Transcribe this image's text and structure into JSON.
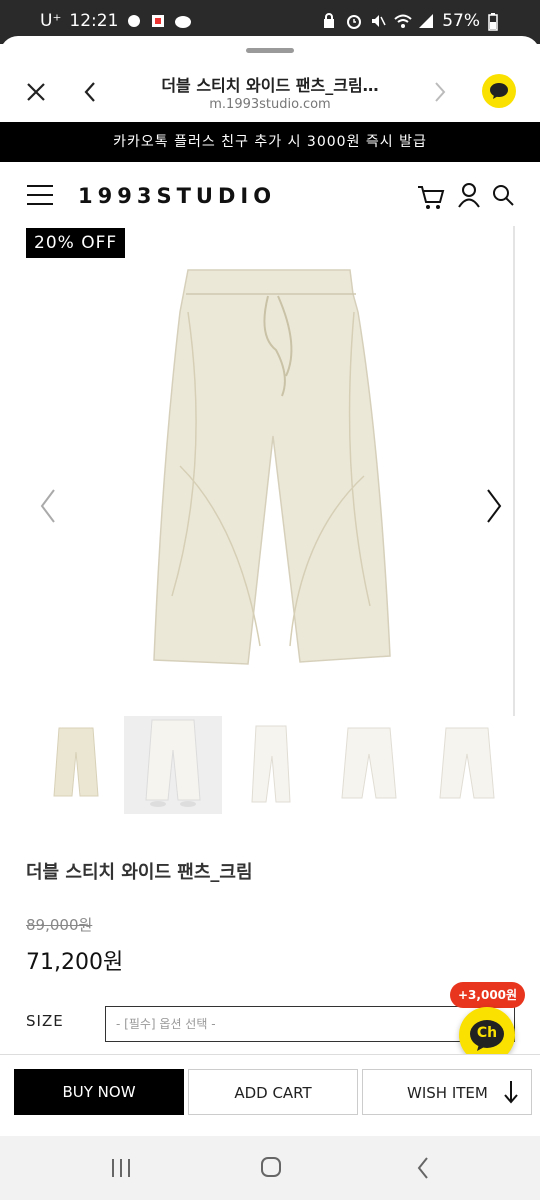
{
  "status_bar": {
    "carrier": "U⁺",
    "time": "12:21",
    "battery": "57%"
  },
  "browser": {
    "title": "더블 스티치 와이드 팬츠_크림…",
    "url": "m.1993studio.com"
  },
  "promo_banner": "카카오톡 플러스 친구 추가 시 3000원 즉시 발급",
  "site": {
    "logo": "1993STUDIO"
  },
  "product": {
    "discount_badge": "20% OFF",
    "name": "더블 스티치 와이드 팬츠_크림",
    "original_price": "89,000원",
    "sale_price": "71,200원",
    "size_label": "SIZE",
    "size_placeholder": "- [필수] 옵션 선택 -",
    "thumbnail_count": 5
  },
  "floating": {
    "points_badge": "+3,000원",
    "channel_label": "Ch"
  },
  "actions": {
    "buy_now": "BUY NOW",
    "add_cart": "ADD CART",
    "wish_item": "WISH ITEM"
  },
  "colors": {
    "banner_bg": "#000000",
    "kakao_yellow": "#fae100",
    "points_red": "#e8361e",
    "pants_cream": "#ece8d8"
  }
}
